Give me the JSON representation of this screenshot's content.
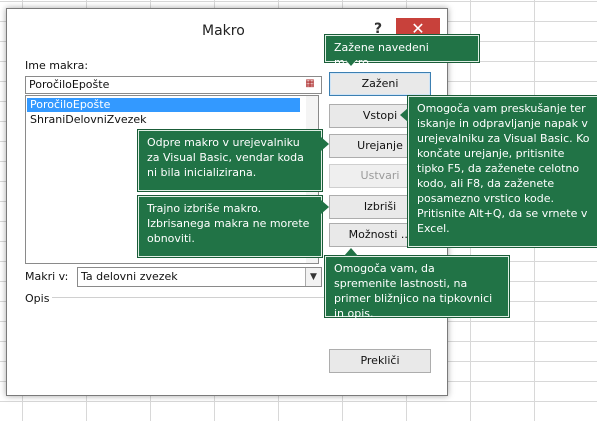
{
  "dialog": {
    "title": "Makro",
    "help": "?",
    "close": "✕",
    "name_label": "Ime makra:",
    "name_value": "PoročiloEpošte",
    "macros": [
      "PoročiloEpošte",
      "ShraniDelovniZvezek"
    ],
    "macros_in_label": "Makri v:",
    "macros_in_value": "Ta delovni zvezek",
    "description_label": "Opis"
  },
  "buttons": {
    "run": "Zaženi",
    "step_into": "Vstopi",
    "edit": "Urejanje",
    "create": "Ustvari",
    "delete": "Izbriši",
    "options": "Možnosti ...",
    "cancel": "Prekliči"
  },
  "tooltips": {
    "run": "Zažene navedeni makro.",
    "step_into": "Omogoča vam preskušanje ter iskanje in odpravljanje napak v urejevalniku za Visual Basic. Ko končate urejanje, pritisnite tipko F5, da zaženete celotno kodo, ali F8, da zaženete posamezno vrstico kode. Pritisnite Alt+Q, da se vrnete v Excel.",
    "edit": "Odpre makro v urejevalniku za Visual Basic, vendar koda ni bila inicializirana.",
    "delete": "Trajno izbriše makro. Izbrisanega makra ne morete obnoviti.",
    "options": "Omogoča vam, da spremenite lastnosti, na primer bližnjico na tipkovnici in opis."
  },
  "colors": {
    "tooltip_bg": "#217346",
    "selection": "#3399ff",
    "close_bg": "#c8413b"
  }
}
